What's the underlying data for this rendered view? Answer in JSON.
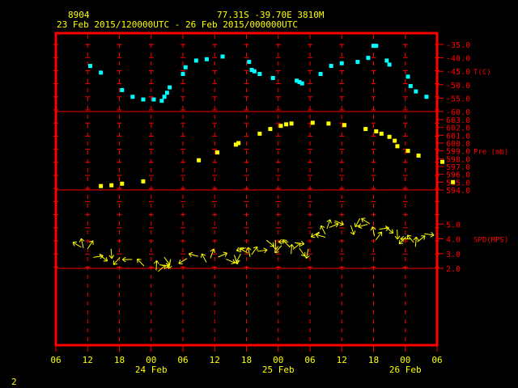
{
  "header": {
    "station_id": "8904",
    "location": "77.31S  -39.70E  3810M",
    "time_range": "23 Feb 2015/120000UTC - 26 Feb 2015/000000UTC"
  },
  "footer_label": "2",
  "colors": {
    "background": "#000000",
    "frame": "#ff0000",
    "gridline": "#ff0000",
    "tick_label": "#ff0000",
    "axis_label": "#ffff00",
    "temperature": "#00ffff",
    "pressure": "#ffff00",
    "wind": "#ffff00"
  },
  "x_axis": {
    "tick_labels": [
      "06",
      "12",
      "18",
      "00",
      "06",
      "12",
      "18",
      "00",
      "06",
      "12",
      "18",
      "00",
      "06"
    ],
    "day_labels": [
      "24 Feb",
      "25 Feb",
      "26 Feb"
    ]
  },
  "chart_data": [
    {
      "type": "scatter",
      "ylabel": "T(C)",
      "ylim": [
        -60,
        -35
      ],
      "yticks": [
        "-35.0",
        "-40.0",
        "-45.0",
        "-50.0",
        "-55.0",
        "-60.0"
      ],
      "x_units": "hours since 23 Feb 2015 06 UTC",
      "x": [
        6.5,
        8.5,
        12.5,
        14.5,
        16.5,
        18.5,
        20.0,
        20.5,
        21.0,
        21.5,
        24.0,
        24.5,
        26.5,
        28.5,
        31.5,
        36.5,
        37.0,
        37.5,
        38.5,
        41.0,
        45.5,
        46.0,
        46.5,
        50.0,
        52.0,
        54.0,
        57.0,
        59.0,
        60.0,
        60.5,
        62.5,
        63.0,
        66.5,
        67.0,
        68.0,
        70.0
      ],
      "y": [
        -43.0,
        -45.5,
        -52.0,
        -54.5,
        -55.5,
        -55.5,
        -56.0,
        -54.5,
        -53.0,
        -51.0,
        -46.0,
        -43.5,
        -41.0,
        -40.5,
        -39.5,
        -41.5,
        -44.5,
        -45.0,
        -46.0,
        -47.5,
        -48.5,
        -49.0,
        -49.5,
        -46.0,
        -43.0,
        -42.0,
        -41.5,
        -40.0,
        -35.5,
        -35.5,
        -41.0,
        -42.5,
        -47.0,
        -50.5,
        -52.5,
        -54.5
      ]
    },
    {
      "type": "scatter",
      "ylabel": "Pre (mb)",
      "ylim": [
        594,
        603
      ],
      "yticks": [
        "603.0",
        "602.0",
        "601.0",
        "600.0",
        "599.0",
        "598.0",
        "597.0",
        "596.0",
        "595.0",
        "594.0"
      ],
      "x_units": "hours since 23 Feb 2015 06 UTC",
      "x": [
        8.5,
        10.5,
        12.5,
        16.5,
        27.0,
        30.5,
        34.0,
        34.5,
        38.5,
        40.5,
        42.5,
        43.5,
        44.5,
        48.5,
        51.5,
        54.5,
        58.5,
        60.5,
        61.5,
        63.0,
        64.0,
        64.5,
        66.5,
        68.5,
        73.0,
        75.0
      ],
      "y": [
        594.5,
        594.6,
        594.8,
        595.1,
        597.8,
        598.8,
        599.8,
        600.0,
        601.2,
        601.8,
        602.2,
        602.4,
        602.5,
        602.6,
        602.5,
        602.3,
        601.8,
        601.5,
        601.2,
        600.8,
        600.3,
        599.6,
        599.0,
        598.4,
        597.6,
        595.0
      ]
    },
    {
      "type": "scatter",
      "ylabel": "SPD(MPS)",
      "ylim": [
        2.0,
        6.0
      ],
      "yticks": [
        "5.0",
        "4.0",
        "3.0",
        "2.0"
      ],
      "x_units": "hours since 23 Feb 2015 06 UTC",
      "x": [
        4.0,
        5.0,
        6.5,
        8.0,
        9.0,
        10.5,
        11.5,
        13.5,
        16.0,
        19.0,
        20.0,
        20.5,
        21.0,
        21.5,
        24.0,
        26.0,
        28.0,
        29.5,
        31.5,
        33.0,
        34.0,
        34.5,
        35.0,
        35.5,
        36.5,
        37.5,
        39.0,
        40.5,
        41.5,
        42.0,
        43.0,
        43.5,
        44.5,
        45.5,
        46.0,
        46.5,
        47.5,
        49.0,
        50.0,
        50.5,
        51.5,
        52.5,
        53.5,
        56.0,
        57.0,
        58.0,
        58.5,
        60.0,
        61.0,
        62.0,
        63.0,
        64.5,
        65.5,
        66.0,
        67.0,
        68.0,
        69.0,
        70.5
      ],
      "y": [
        3.6,
        3.7,
        3.6,
        2.8,
        2.7,
        3.0,
        2.5,
        2.6,
        2.4,
        2.2,
        2.0,
        2.2,
        2.5,
        2.3,
        2.5,
        2.9,
        2.7,
        3.0,
        2.9,
        2.5,
        2.6,
        2.7,
        3.3,
        3.2,
        3.1,
        3.2,
        3.2,
        3.7,
        3.6,
        3.3,
        3.8,
        3.7,
        3.3,
        3.5,
        3.7,
        3.1,
        3.0,
        4.3,
        4.2,
        4.6,
        5.0,
        4.9,
        5.1,
        4.6,
        5.1,
        4.9,
        5.2,
        4.5,
        4.2,
        4.7,
        4.6,
        4.3,
        3.9,
        4.0,
        4.0,
        3.8,
        4.0,
        4.3
      ]
    }
  ]
}
